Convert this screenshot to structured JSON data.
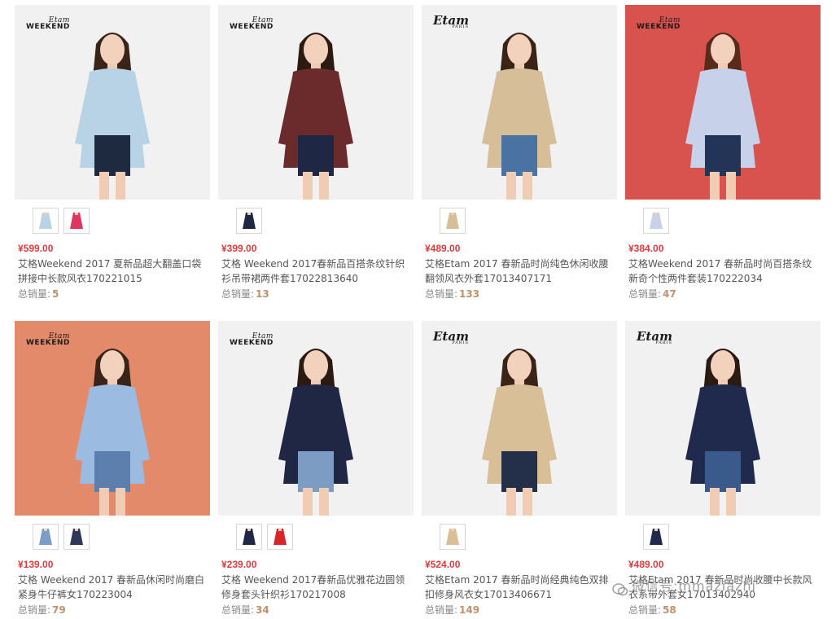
{
  "products": [
    {
      "brand": "WEEKEND",
      "brand_script": "Etam",
      "price": "¥599.00",
      "title": "艾格Weekend 2017 夏新品超大翻盖口袋\n拼接中长款风衣170221015",
      "sales_label": "总销量:",
      "sales": "5",
      "bg": "#f1f1f1",
      "top": "#b8d3e6",
      "bottom": "#1d2a40",
      "hair": "#3a2418",
      "swatch_colors": [
        "#b8d3e6",
        "#e0365e"
      ]
    },
    {
      "brand": "WEEKEND",
      "brand_script": "Etam",
      "price": "¥399.00",
      "title": "艾格 Weekend 2017春新品百搭条纹针织\n衫吊带裙两件套17022813640",
      "sales_label": "总销量:",
      "sales": "13",
      "bg": "#f1f1f1",
      "top": "#6b2a2c",
      "bottom": "#1e2744",
      "hair": "#2a1a12",
      "swatch_colors": [
        "#1e2744"
      ]
    },
    {
      "brand": "Etam",
      "brand_sub": "PARIS",
      "price": "¥489.00",
      "title": "艾格Etam 2017 春新品时尚纯色休闲收腰\n翻领风衣外套17013407171",
      "sales_label": "总销量:",
      "sales": "133",
      "bg": "#f1f1f1",
      "top": "#d6bf98",
      "bottom": "#4a73a4",
      "hair": "#3a2418",
      "swatch_colors": [
        "#d6bf98"
      ]
    },
    {
      "brand": "WEEKEND",
      "brand_script": "Etam",
      "price": "¥384.00",
      "title": "艾格Weekend 2017 春新品时尚百搭条纹\n新奇个性两件套装170222034",
      "sales_label": "总销量:",
      "sales": "47",
      "bg": "#d9534e",
      "top": "#c7d2ea",
      "bottom": "#243456",
      "hair": "#5a2a1a",
      "swatch_colors": [
        "#c7d2ea"
      ]
    },
    {
      "brand": "WEEKEND",
      "brand_script": "Etam",
      "price": "¥139.00",
      "title": "艾格 Weekend 2017 春新品休闲时尚磨白\n紧身牛仔裤女170223004",
      "sales_label": "总销量:",
      "sales": "79",
      "bg": "#e28a6a",
      "top": "#9bbbe0",
      "bottom": "#5d7fae",
      "hair": "#3a2418",
      "swatch_colors": [
        "#7b9cc6",
        "#2c3a58"
      ]
    },
    {
      "brand": "WEEKEND",
      "brand_script": "Etam",
      "price": "¥239.00",
      "title": "艾格 Weekend 2017春新品优雅花边圆领\n修身套头针织衫170217008",
      "sales_label": "总销量:",
      "sales": "34",
      "bg": "#f1f1f1",
      "top": "#1f2745",
      "bottom": "#7c9cc4",
      "hair": "#2a1a12",
      "swatch_colors": [
        "#1f2745",
        "#d8252b"
      ]
    },
    {
      "brand": "Etam",
      "brand_sub": "PARIS",
      "price": "¥524.00",
      "title": "艾格Etam 2017 春新品时尚经典纯色双排\n扣修身风衣女17013406671",
      "sales_label": "总销量:",
      "sales": "149",
      "bg": "#f1f1f1",
      "top": "#d8bf98",
      "bottom": "#24304a",
      "hair": "#3a2418",
      "swatch_colors": [
        "#d8bf98"
      ]
    },
    {
      "brand": "Etam",
      "brand_sub": "PARIS",
      "price": "¥489.00",
      "title": "艾格Etam 2017 春新品时尚收腰中长款风\n衣系带外套女17013402940",
      "sales_label": "总销量:",
      "sales": "58",
      "bg": "#f1f1f1",
      "top": "#1f2a4d",
      "bottom": "#3a5a8c",
      "hair": "#2a1a12",
      "swatch_colors": [
        "#1f2a4d"
      ]
    }
  ],
  "watermark": {
    "text": "微信号:mmaziazhi",
    "icon": "wechat-icon"
  }
}
